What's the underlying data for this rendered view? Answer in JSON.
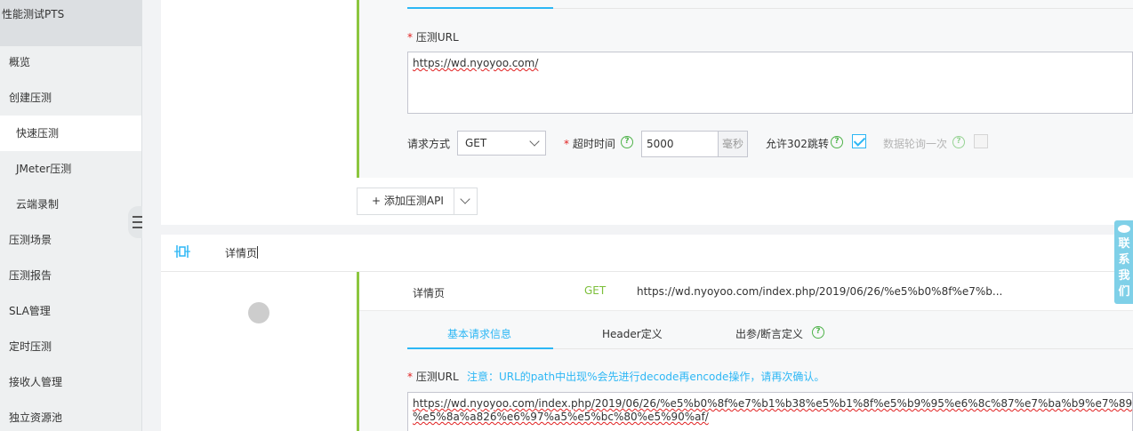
{
  "sidebar": {
    "title": "性能测试PTS",
    "items": [
      {
        "label": "概览"
      },
      {
        "label": "创建压测"
      },
      {
        "label": "快速压测"
      },
      {
        "label": "JMeter压测"
      },
      {
        "label": "云端录制"
      },
      {
        "label": "压测场景"
      },
      {
        "label": "压测报告"
      },
      {
        "label": "SLA管理"
      },
      {
        "label": "定时压测"
      },
      {
        "label": "接收人管理"
      },
      {
        "label": "独立资源池"
      }
    ],
    "active_item": "快速压测"
  },
  "api1": {
    "url_label": "压测URL",
    "required_mark": "*",
    "url_value": "https://wd.nyoyoo.com/",
    "method_label": "请求方式",
    "method_value": "GET",
    "timeout_label": "超时时间",
    "timeout_value": "5000",
    "timeout_unit": "毫秒",
    "redirect_label": "允许302跳转",
    "redirect_checked": true,
    "poll_label": "数据轮询一次",
    "poll_checked": false
  },
  "add_api_button": "+ 添加压测API",
  "scene": {
    "name": "详情页"
  },
  "api2": {
    "name": "详情页",
    "method": "GET",
    "url_short": "https://wd.nyoyoo.com/index.php/2019/06/26/%e5%b0%8f%e7%b...",
    "tabs": [
      {
        "label": "基本请求信息",
        "active": true
      },
      {
        "label": "Header定义",
        "active": false
      },
      {
        "label": "出参/断言定义",
        "active": false
      }
    ],
    "url_label": "压测URL",
    "required_mark": "*",
    "note": "注意：URL的path中出现%会先进行decode再encode操作，请再次确认。",
    "url_value_line1": "https://wd.nyoyoo.com/index.php/2019/06/26/%e5%b0%8f%e7%b1%b38%e5%b1%8f%e5%b9%95%e6%8c%87%e7%ba%b9%e7%89%88%e5%bf%ab%e9%97",
    "url_value_line2": "%e5%8a%a826%e6%97%a5%e5%bc%80%e5%90%af/"
  },
  "contact_widget": "联系我们",
  "colors": {
    "accent": "#2db7f5",
    "green_border": "#8cc63f",
    "get_method": "#7cbf3a",
    "help_icon": "#4fb34a",
    "required": "#e02020"
  }
}
